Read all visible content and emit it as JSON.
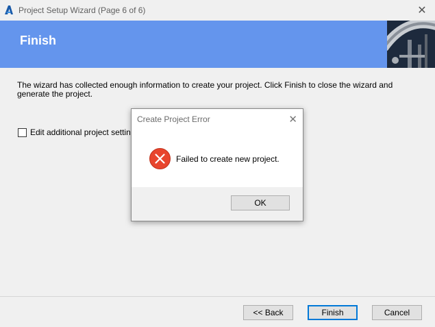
{
  "window": {
    "title": "Project Setup Wizard (Page 6 of 6)",
    "close_glyph": "✕"
  },
  "banner": {
    "title": "Finish"
  },
  "content": {
    "intro_line1": "The wizard has collected enough information to create your project. Click Finish to close the wizard and",
    "intro_line2": "generate the project.",
    "checkbox_label": "Edit additional project settings",
    "checkbox_checked": false
  },
  "footer": {
    "back_label": "<< Back",
    "finish_label": "Finish",
    "cancel_label": "Cancel"
  },
  "dialog": {
    "title": "Create Project Error",
    "close_glyph": "✕",
    "message": "Failed to create new project.",
    "ok_label": "OK",
    "icon": "error-icon"
  },
  "colors": {
    "banner": "#6495ed",
    "error_red": "#e8452d",
    "default_button_border": "#0078d7"
  }
}
